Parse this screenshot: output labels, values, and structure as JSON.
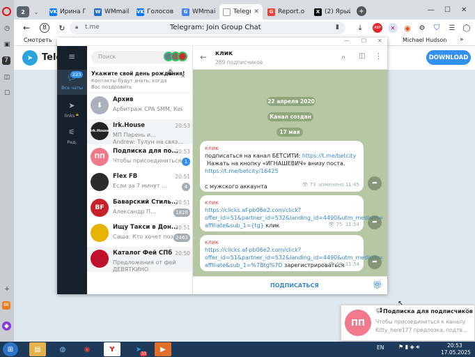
{
  "browser": {
    "tab_count": "2",
    "tabs": [
      {
        "label": "Ирина П",
        "fav": "VK",
        "color": "#0077ff"
      },
      {
        "label": "WMmail.r",
        "fav": "W",
        "color": "#1f6fd0"
      },
      {
        "label": "Голосова",
        "fav": "VK",
        "color": "#0077ff"
      },
      {
        "label": "WMmail.r",
        "fav": "G",
        "color": "#4285f4"
      },
      {
        "label": "Telegra",
        "fav": "",
        "color": "#999999"
      },
      {
        "label": "Report.o",
        "fav": "G",
        "color": "#ea4335"
      },
      {
        "label": "(2) Ярый",
        "fav": "X",
        "color": "#000000"
      }
    ],
    "domain": "t.me",
    "page_title": "Telegram: Join Group Chat",
    "bookmarks": {
      "first": "Смотреть",
      "last": "Michael Hudson"
    }
  },
  "tg_page": {
    "logo_text": "Teleg",
    "download_label": "DOWNLOAD"
  },
  "sidebar": {
    "all_chats_badge": "223",
    "all_chats_label": "Все чаты",
    "links_label": "links",
    "edit_label": "Ред."
  },
  "chatlist": {
    "search_placeholder": "Поиск",
    "birthday_title": "Укажите свой день рождения!",
    "birthday_sub": "Контакты будут знать, когда Вас поздравить",
    "archive_title": "Архив",
    "archive_preview": "Арбитраж CPA SMM, Кейсы ...",
    "chats": [
      {
        "name": "Irk.House",
        "preview": "МП   Парень и...",
        "preview2": "Andrew: Тулун на связ...",
        "time": "20:53",
        "badge": "",
        "ava_text": "Irk.House",
        "ava_color": "#222222"
      },
      {
        "name": "Подписка для по...",
        "preview": "Чтобы присоединиться...",
        "time": "20:53",
        "badge": "1",
        "ava_text": "ПП",
        "ava_color": "#f07a8c",
        "badge_color": "#3390ec"
      },
      {
        "name": "Flex FB",
        "preview": "Если за 7 минут ...",
        "time": "20:51",
        "badge": "4",
        "ava_text": "",
        "ava_color": "#2b2b2b"
      },
      {
        "name": "Баварский Стиль...",
        "preview": "Александр П...",
        "time": "20:51",
        "badge": "1828",
        "ava_text": "BF",
        "ava_color": "#c8202a"
      },
      {
        "name": "Ищу Такси в Дон...",
        "preview": "Саша: Кто хочет поз...",
        "time": "20:51",
        "badge": "2463",
        "ava_text": "",
        "ava_color": "#e8b300"
      },
      {
        "name": "Каталог Фей СПб",
        "preview": "Предложения от фей",
        "preview2": "ДЕВЯТКИНО",
        "time": "20:50",
        "badge": "",
        "ava_text": "",
        "ava_color": "#c0112c"
      }
    ]
  },
  "channel": {
    "name": "клик",
    "subscribers": "289 подписчиков",
    "date_pill": "22 апреля 2020",
    "created_pill": "Канал создан",
    "day_pill": "17 мая",
    "subscribe_label": "ПОДПИСАТЬСЯ",
    "messages": [
      {
        "author": "клик",
        "line1": "подписаться  на канал БЕТСИТИ: ",
        "line1_link": "https://t.me/betcity",
        "line2": "Нажать на кнопку «ИГНАШЕВИЧ» внизу поста.",
        "line3_link": "https://t.me/betcity/16425",
        "line4": "с  мужского аккаунта",
        "views": "73",
        "meta": "изменено 11:45"
      },
      {
        "author": "клик",
        "link1": "https://clicks.af-pb06e2.com/click?",
        "link2": "offer_id=51&partner_id=532&landing_id=4490&utm_medium=",
        "link3": "affiliate&sub_1={tg}",
        "tail": " клик",
        "views": "75",
        "meta": "11:54"
      },
      {
        "author": "клик",
        "link1": "https://clicks.af-pb06e2.com/click?",
        "link2": "offer_id=51&partner_id=532&landing_id=4490&utm_medium=",
        "link3": "affiliate&sub_1=%7Btg%7D",
        "tail": " зарегистрироваться",
        "views": "67",
        "meta": "11:54"
      }
    ]
  },
  "notification": {
    "ava_text": "ПП",
    "title": "Подписка для подписчиков",
    "line1": "Чтобы присоединиться к каналу",
    "line2": "Kitty_here177 предлоэка, подтв..."
  },
  "taskbar": {
    "lang": "EN",
    "time": "20:53",
    "date": "17.05.2025",
    "tg_badge": "33"
  }
}
